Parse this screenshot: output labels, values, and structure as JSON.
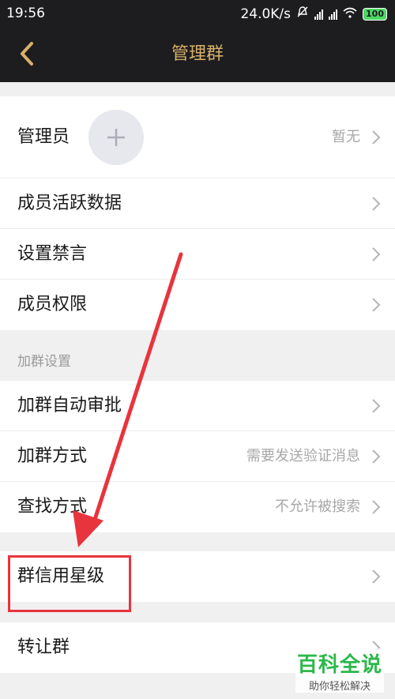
{
  "status_bar": {
    "time": "19:56",
    "speed": "24.0K/s",
    "battery": "100"
  },
  "nav": {
    "title": "管理群",
    "back_icon": "chevron-left-icon"
  },
  "management_section": {
    "admin": {
      "label": "管理员",
      "value": "暂无"
    },
    "items": [
      {
        "label": "成员活跃数据"
      },
      {
        "label": "设置禁言"
      },
      {
        "label": "成员权限"
      }
    ]
  },
  "join_section": {
    "header": "加群设置",
    "items": [
      {
        "label": "加群自动审批",
        "value": ""
      },
      {
        "label": "加群方式",
        "value": "需要发送验证消息"
      },
      {
        "label": "查找方式",
        "value": "不允许被搜索"
      }
    ]
  },
  "credit": {
    "label": "群信用星级"
  },
  "transfer": {
    "label": "转让群"
  },
  "watermark": {
    "main": "百科全说",
    "sub": "助你轻松解决"
  },
  "colors": {
    "nav_background": "#1d1d1f",
    "nav_title": "#d8b06a",
    "annotation_red": "#e8343d",
    "watermark_green": "#2cb84b"
  }
}
